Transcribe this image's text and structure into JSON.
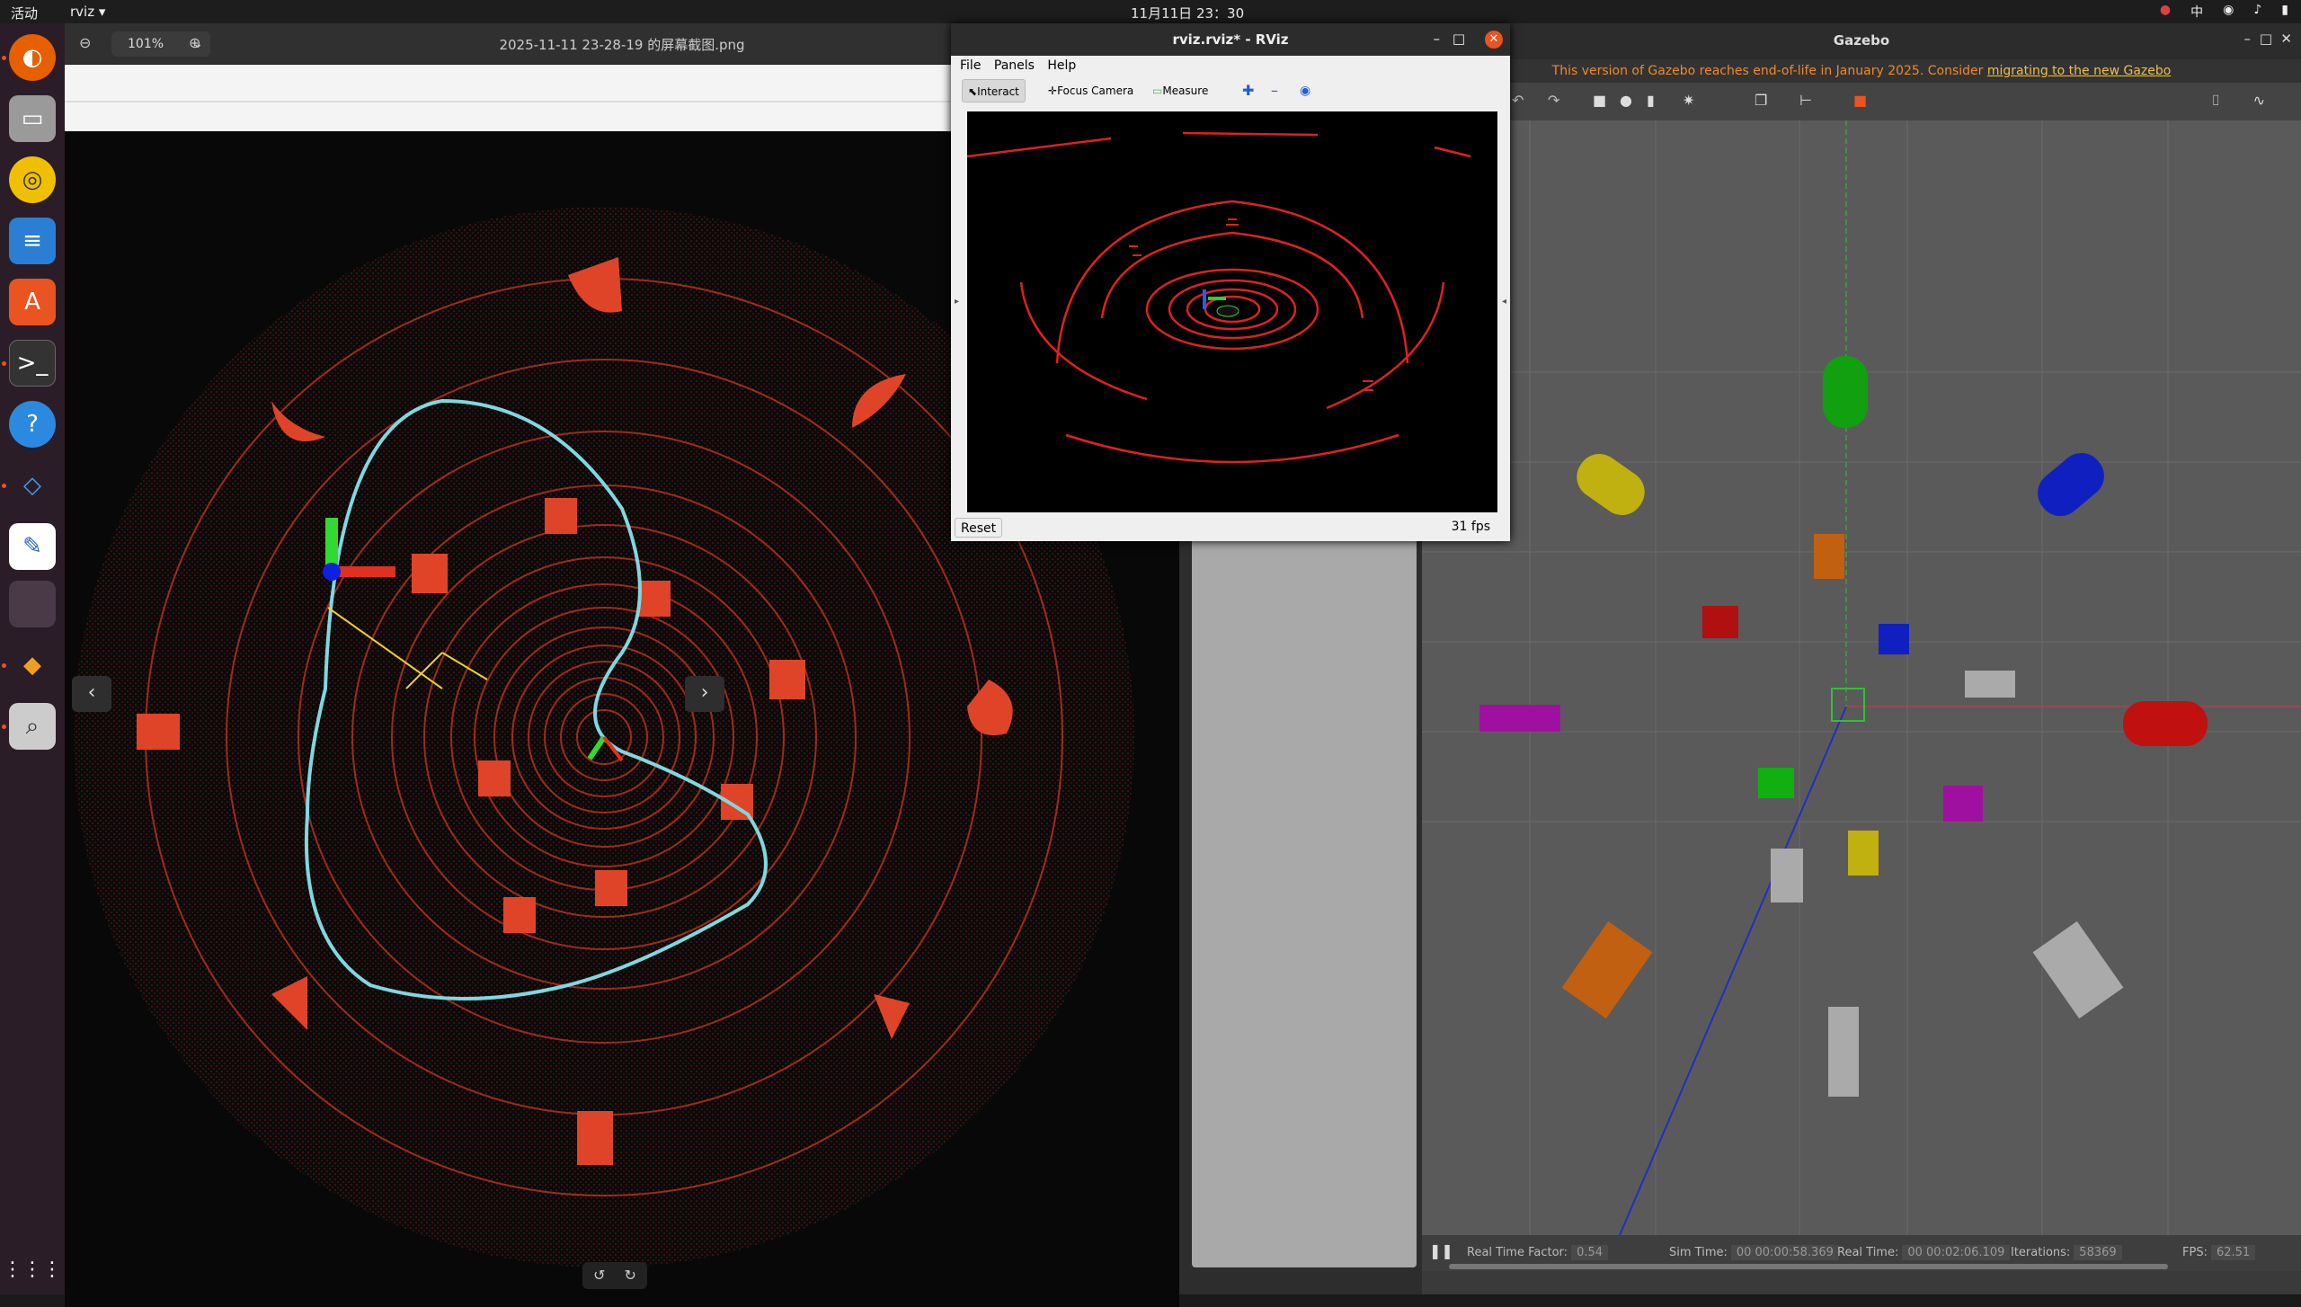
{
  "topbar": {
    "activities": "活动",
    "app_name": "rviz",
    "clock": "11月11日 23：30",
    "tray_items": [
      "中",
      "⚡",
      "🔊",
      "🔋"
    ]
  },
  "viewer": {
    "zoom_level": "101%",
    "title": "2025-11-11 23-28-19 的屏幕截图.png",
    "prev_label": "‹",
    "next_label": "›"
  },
  "rviz": {
    "title": "rviz.rviz* - RViz",
    "menu": {
      "file": "File",
      "panels": "Panels",
      "help": "Help"
    },
    "tools": {
      "interact": "Interact",
      "focus_camera": "Focus Camera",
      "measure": "Measure"
    },
    "reset_label": "Reset",
    "fps": "31 fps"
  },
  "gazebo": {
    "title": "Gazebo",
    "warning_text": "This version of Gazebo reaches end-of-life in January 2025. Consider ",
    "warning_link": "migrating to the new Gazebo",
    "status": {
      "rtf_label": "Real Time Factor:",
      "rtf_value": "0.54",
      "sim_label": "Sim Time:",
      "sim_value": "00 00:00:58.369",
      "real_label": "Real Time:",
      "real_value": "00 00:02:06.109",
      "iter_label": "Iterations:",
      "iter_value": "58369",
      "fps_label": "FPS:",
      "fps_value": "62.51"
    }
  },
  "colors": {
    "accent": "#e95420",
    "path": "#7fd8e0",
    "lidar": "#e0321e"
  }
}
